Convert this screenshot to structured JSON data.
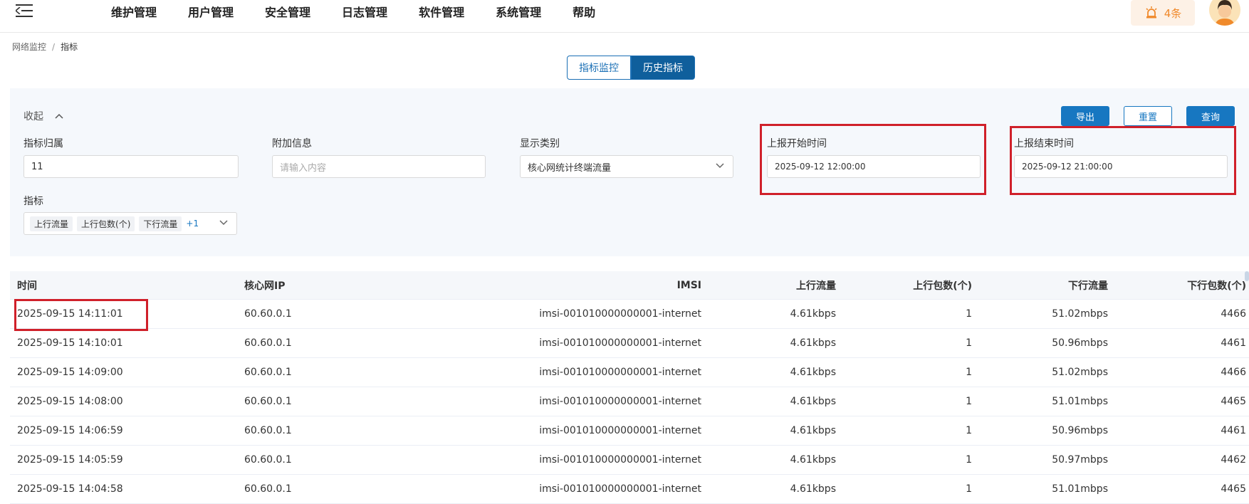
{
  "nav": {
    "items": [
      "维护管理",
      "用户管理",
      "安全管理",
      "日志管理",
      "软件管理",
      "系统管理",
      "帮助"
    ],
    "alarm_count": "4条"
  },
  "breadcrumb": {
    "parent": "网络监控",
    "separator": "/",
    "current": "指标"
  },
  "tabs": {
    "monitor": "指标监控",
    "history": "历史指标"
  },
  "filter": {
    "collapse_label": "收起",
    "buttons": {
      "export": "导出",
      "reset": "重置",
      "query": "查询"
    },
    "fields": {
      "owner": {
        "label": "指标归属",
        "value": "11"
      },
      "extra": {
        "label": "附加信息",
        "placeholder": "请输入内容"
      },
      "category": {
        "label": "显示类别",
        "value": "核心网统计终端流量"
      },
      "start": {
        "label": "上报开始时间",
        "value": "2025-09-12 12:00:00"
      },
      "end": {
        "label": "上报结束时间",
        "value": "2025-09-12 21:00:00"
      },
      "metric": {
        "label": "指标",
        "tags": [
          "上行流量",
          "上行包数(个)",
          "下行流量"
        ],
        "more": "+1"
      }
    }
  },
  "table": {
    "headers": [
      "时间",
      "核心网IP",
      "IMSI",
      "上行流量",
      "上行包数(个)",
      "下行流量",
      "下行包数(个)"
    ],
    "rows": [
      [
        "2025-09-15 14:11:01",
        "60.60.0.1",
        "imsi-001010000000001-internet",
        "4.61kbps",
        "1",
        "51.02mbps",
        "4466"
      ],
      [
        "2025-09-15 14:10:01",
        "60.60.0.1",
        "imsi-001010000000001-internet",
        "4.61kbps",
        "1",
        "50.96mbps",
        "4461"
      ],
      [
        "2025-09-15 14:09:00",
        "60.60.0.1",
        "imsi-001010000000001-internet",
        "4.61kbps",
        "1",
        "51.02mbps",
        "4466"
      ],
      [
        "2025-09-15 14:08:00",
        "60.60.0.1",
        "imsi-001010000000001-internet",
        "4.61kbps",
        "1",
        "51.01mbps",
        "4465"
      ],
      [
        "2025-09-15 14:06:59",
        "60.60.0.1",
        "imsi-001010000000001-internet",
        "4.61kbps",
        "1",
        "50.96mbps",
        "4461"
      ],
      [
        "2025-09-15 14:05:59",
        "60.60.0.1",
        "imsi-001010000000001-internet",
        "4.61kbps",
        "1",
        "50.97mbps",
        "4462"
      ],
      [
        "2025-09-15 14:04:58",
        "60.60.0.1",
        "imsi-001010000000001-internet",
        "4.61kbps",
        "1",
        "51.01mbps",
        "4465"
      ]
    ]
  },
  "colors": {
    "primary": "#1777c1",
    "highlight": "#d0202a",
    "alarm": "#f0892b"
  }
}
